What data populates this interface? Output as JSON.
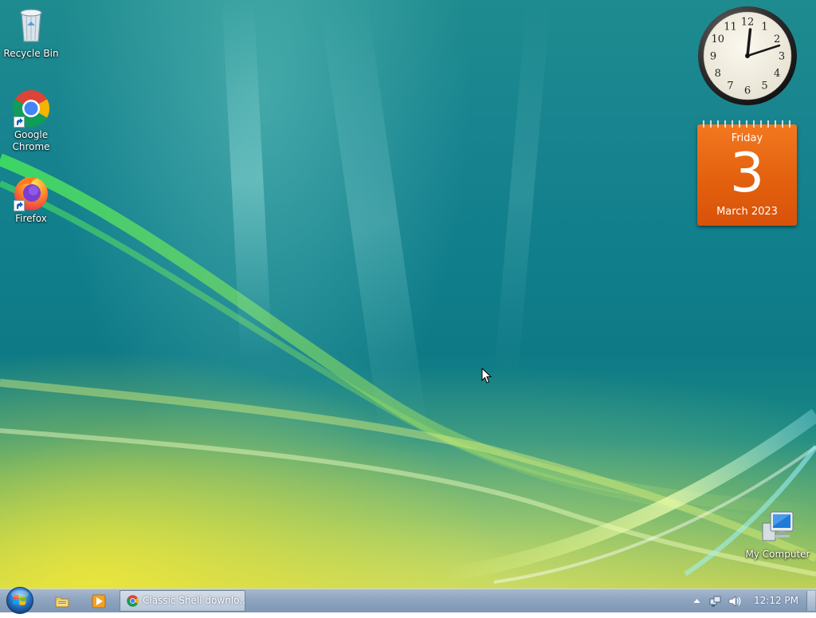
{
  "desktop_icons": {
    "recycle_bin": "Recycle Bin",
    "chrome": "Google Chrome",
    "firefox": "Firefox",
    "my_computer": "My Computer"
  },
  "gadgets": {
    "clock": {
      "time": "12:12",
      "numerals": [
        "12",
        "1",
        "2",
        "3",
        "4",
        "5",
        "6",
        "7",
        "8",
        "9",
        "10",
        "11"
      ]
    },
    "calendar": {
      "day_name": "Friday",
      "day_number": "3",
      "month_year": "March 2023"
    }
  },
  "taskbar": {
    "start_icon": "windows-orb-icon",
    "quick_launch": [
      "folder-icon",
      "media-player-icon"
    ],
    "tasks": [
      {
        "label": "Classic Shell downlo...",
        "icon": "chrome-icon"
      }
    ],
    "tray_icons": [
      "chevron-up-icon",
      "network-icon",
      "volume-icon"
    ],
    "clock": "12:12 PM"
  },
  "colors": {
    "taskbar": "#8ea4bf",
    "calendar": "#e25f0d",
    "desktop": "#107e8b"
  }
}
